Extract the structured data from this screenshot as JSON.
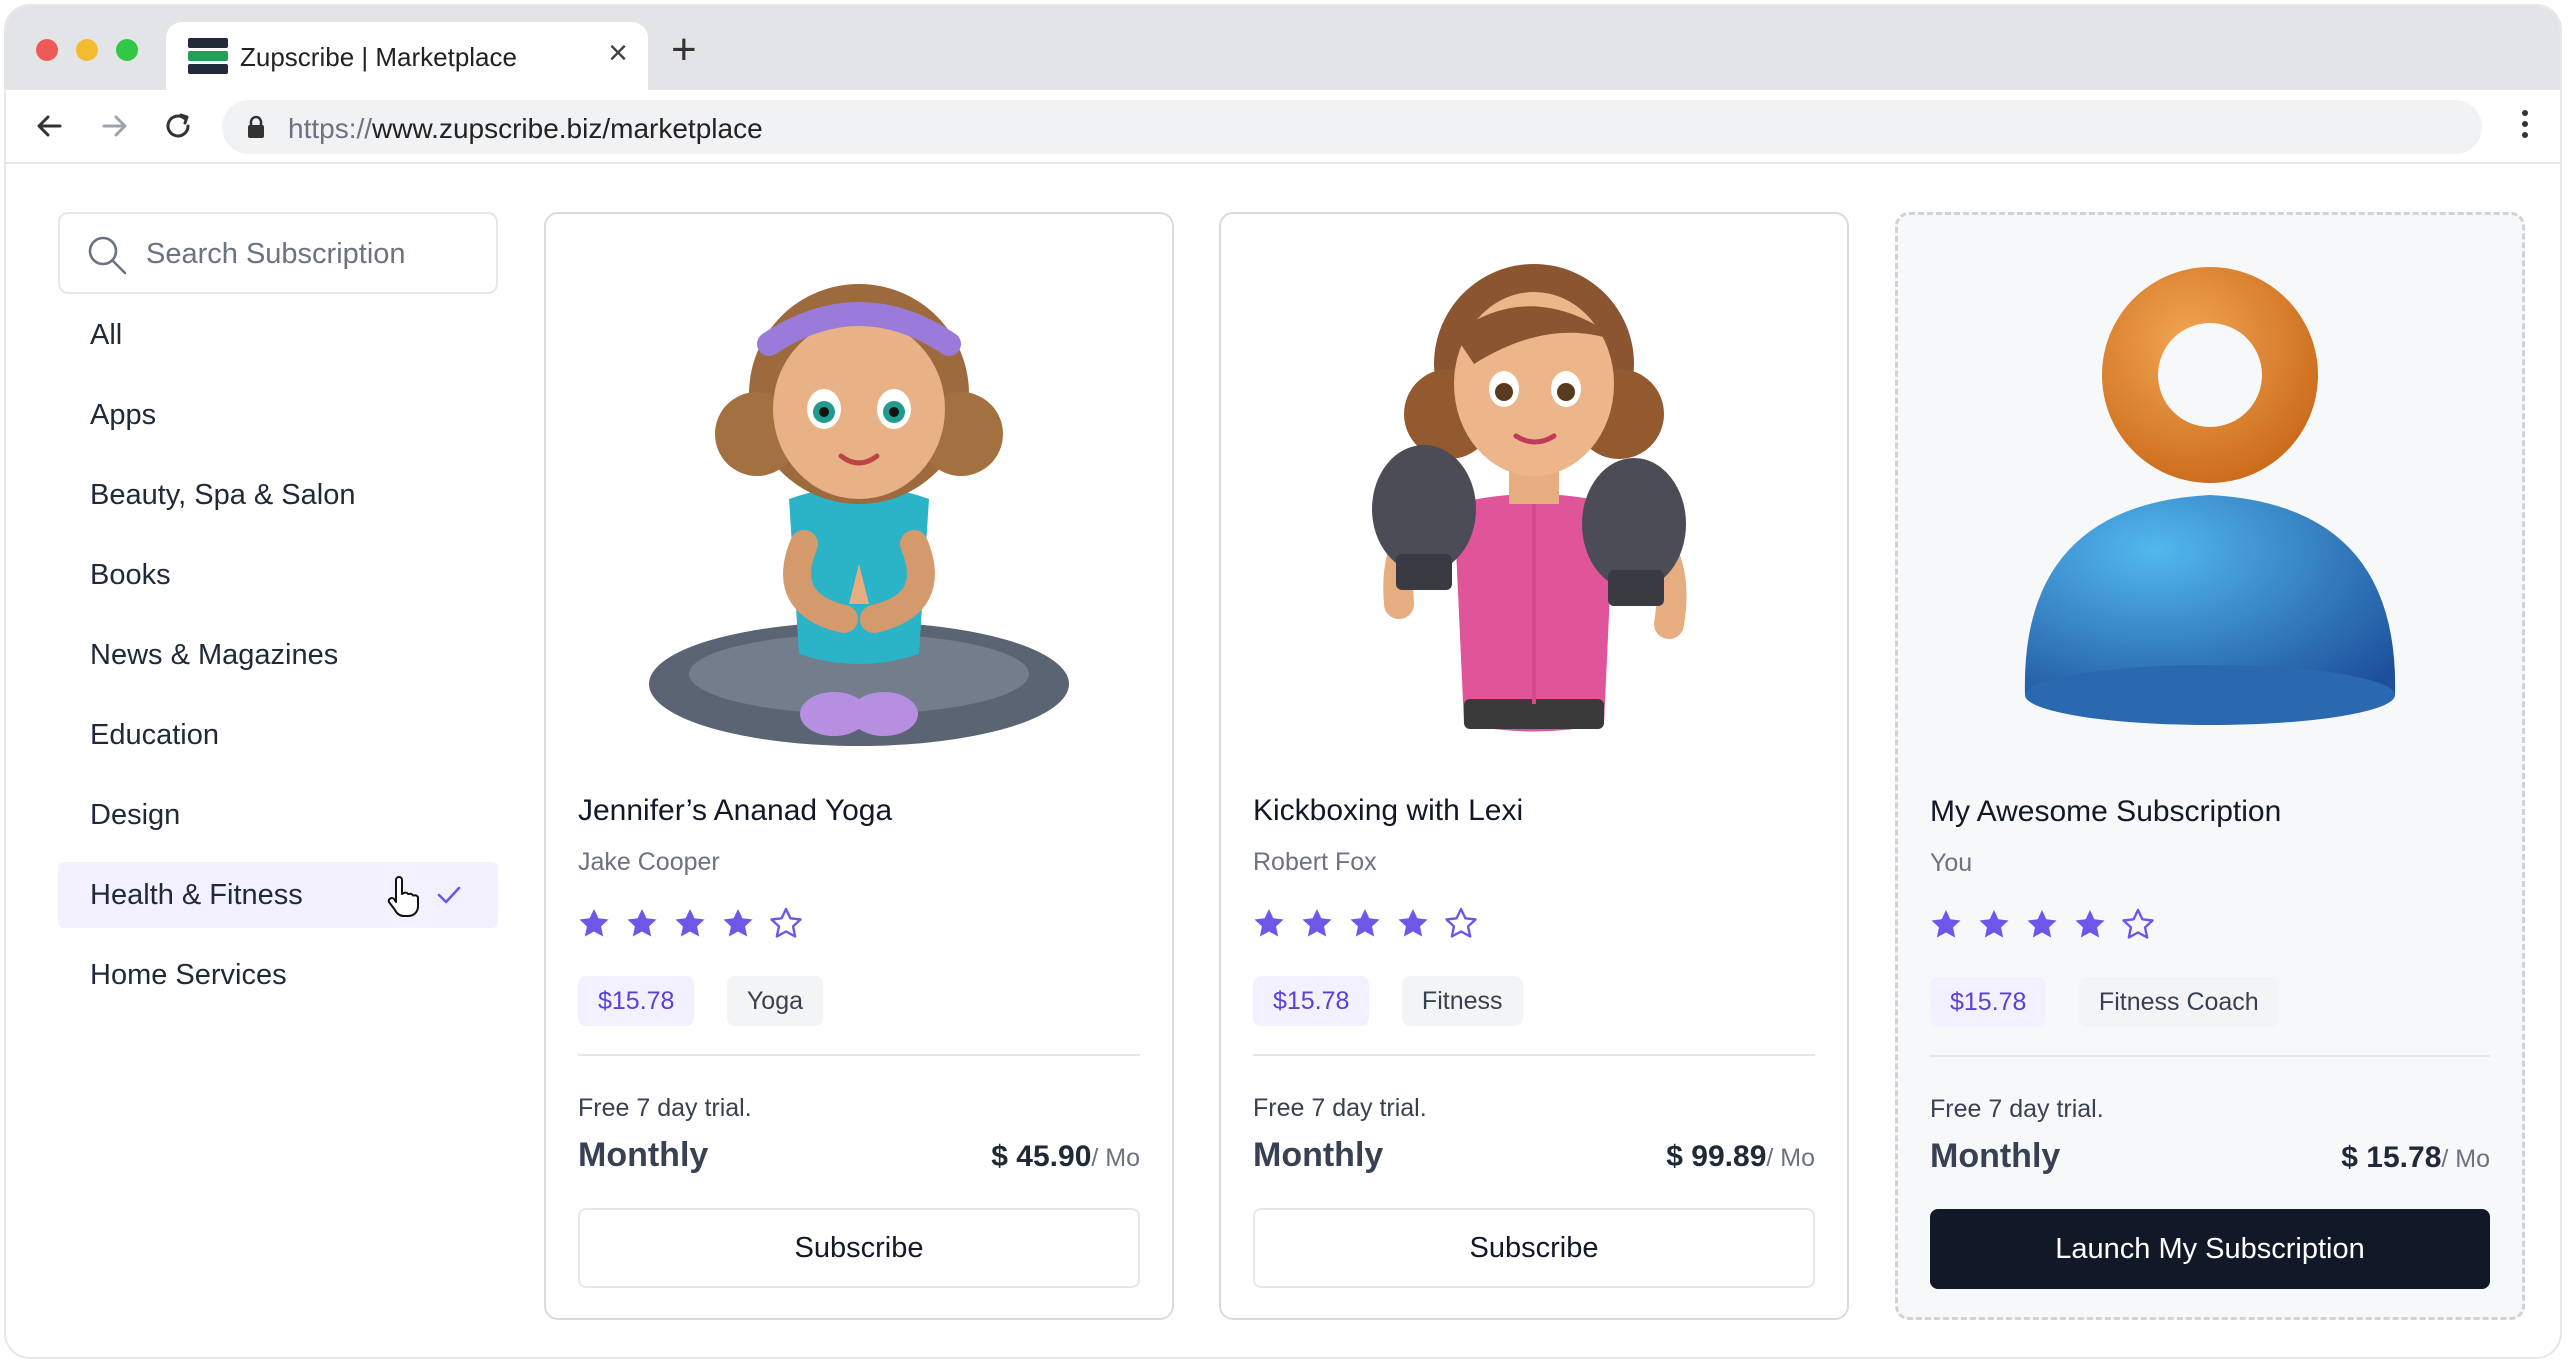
{
  "browser": {
    "tab_title": "Zupscribe | Marketplace",
    "url_protocol": "https://",
    "url_rest": "www.zupscribe.biz/marketplace",
    "close_glyph": "×",
    "new_tab_glyph": "+"
  },
  "sidebar": {
    "search_placeholder": "Search Subscription",
    "categories": [
      {
        "label": "All"
      },
      {
        "label": "Apps"
      },
      {
        "label": "Beauty, Spa & Salon"
      },
      {
        "label": "Books"
      },
      {
        "label": "News & Magazines"
      },
      {
        "label": "Education"
      },
      {
        "label": "Design"
      },
      {
        "label": "Health & Fitness",
        "selected": true
      },
      {
        "label": "Home Services"
      }
    ]
  },
  "cards": [
    {
      "title": "Jennifer’s Ananad Yoga",
      "author": "Jake Cooper",
      "rating": 4,
      "rating_max": 5,
      "price_tag": "$15.78",
      "category_tag": "Yoga",
      "trial": "Free 7 day trial.",
      "plan": "Monthly",
      "price": "$ 45.90",
      "price_unit": "/ Mo",
      "button": "Subscribe",
      "image": "yoga-girl-illustration"
    },
    {
      "title": "Kickboxing with Lexi",
      "author": "Robert Fox",
      "rating": 4,
      "rating_max": 5,
      "price_tag": "$15.78",
      "category_tag": "Fitness",
      "trial": "Free 7 day trial.",
      "plan": "Monthly",
      "price": "$ 99.89",
      "price_unit": "/ Mo",
      "button": "Subscribe",
      "image": "boxer-girl-illustration"
    },
    {
      "title": "My Awesome Subscription",
      "author": "You",
      "rating": 4,
      "rating_max": 5,
      "price_tag": "$15.78",
      "category_tag": "Fitness Coach",
      "trial": "Free 7 day trial.",
      "plan": "Monthly",
      "price": "$ 15.78",
      "price_unit": "/ Mo",
      "button": "Launch My Subscription",
      "image": "user-avatar-3d-icon"
    }
  ],
  "colors": {
    "accent": "#6e56e8",
    "accent_bg": "#f3f0ff",
    "dark_button": "#111827",
    "brand_green": "#22a05a"
  }
}
